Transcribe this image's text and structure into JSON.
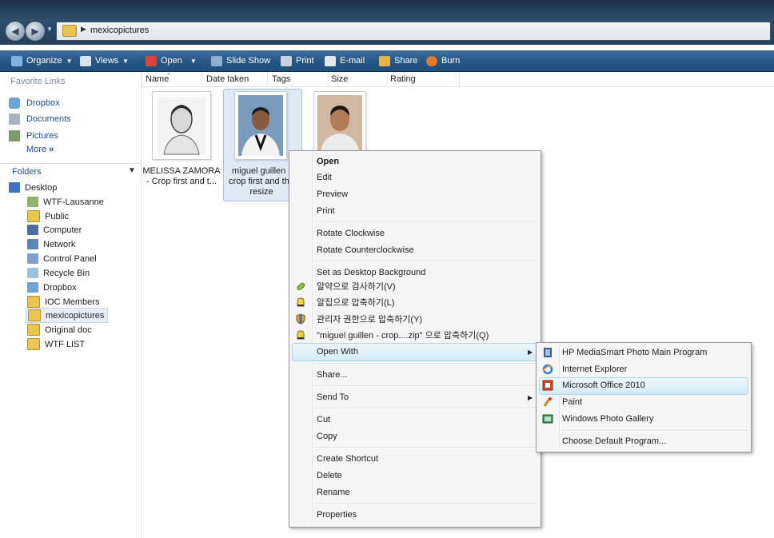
{
  "address": {
    "path": "mexicopictures"
  },
  "commandbar": {
    "organize": "Organize",
    "views": "Views",
    "open": "Open",
    "slideshow": "Slide Show",
    "print": "Print",
    "email": "E-mail",
    "share": "Share",
    "burn": "Burn"
  },
  "sidebar": {
    "favorites_title": "Favorite Links",
    "favorites": [
      "Dropbox",
      "Documents",
      "Pictures"
    ],
    "more": "More",
    "folders_title": "Folders",
    "tree": [
      "Desktop",
      "WTF-Lausanne",
      "Public",
      "Computer",
      "Network",
      "Control Panel",
      "Recycle Bin",
      "Dropbox",
      "IOC Members",
      "mexicopictures",
      "Original doc",
      "WTF LIST"
    ]
  },
  "columns": [
    "Name",
    "Date taken",
    "Tags",
    "Size",
    "Rating"
  ],
  "files": [
    {
      "line1": "MELISSA ZAMORA",
      "line2": "- Crop first and t..."
    },
    {
      "line1": "miguel guillen -",
      "line2": "crop first and the",
      "line3": "resize"
    },
    {
      "line1": ""
    }
  ],
  "context_menu": {
    "open": "Open",
    "edit": "Edit",
    "preview": "Preview",
    "print": "Print",
    "rotate_cw": "Rotate Clockwise",
    "rotate_ccw": "Rotate Counterclockwise",
    "set_bg": "Set as Desktop Background",
    "alyac_scan": "알약으로 검사하기(V)",
    "alzip_compress": "알집으로 압축하기(L)",
    "admin_compress": "관리자 권한으로 압축하기(Y)",
    "zip_compress": "\"miguel guillen - crop....zip\" 으로 압축하기(Q)",
    "open_with": "Open With",
    "share": "Share...",
    "send_to": "Send To",
    "cut": "Cut",
    "copy": "Copy",
    "create_shortcut": "Create Shortcut",
    "delete": "Delete",
    "rename": "Rename",
    "properties": "Properties"
  },
  "open_with_menu": {
    "hp": "HP MediaSmart Photo Main Program",
    "ie": "Internet Explorer",
    "office": "Microsoft Office 2010",
    "paint": "Paint",
    "wpg": "Windows Photo Gallery",
    "choose": "Choose Default Program..."
  }
}
